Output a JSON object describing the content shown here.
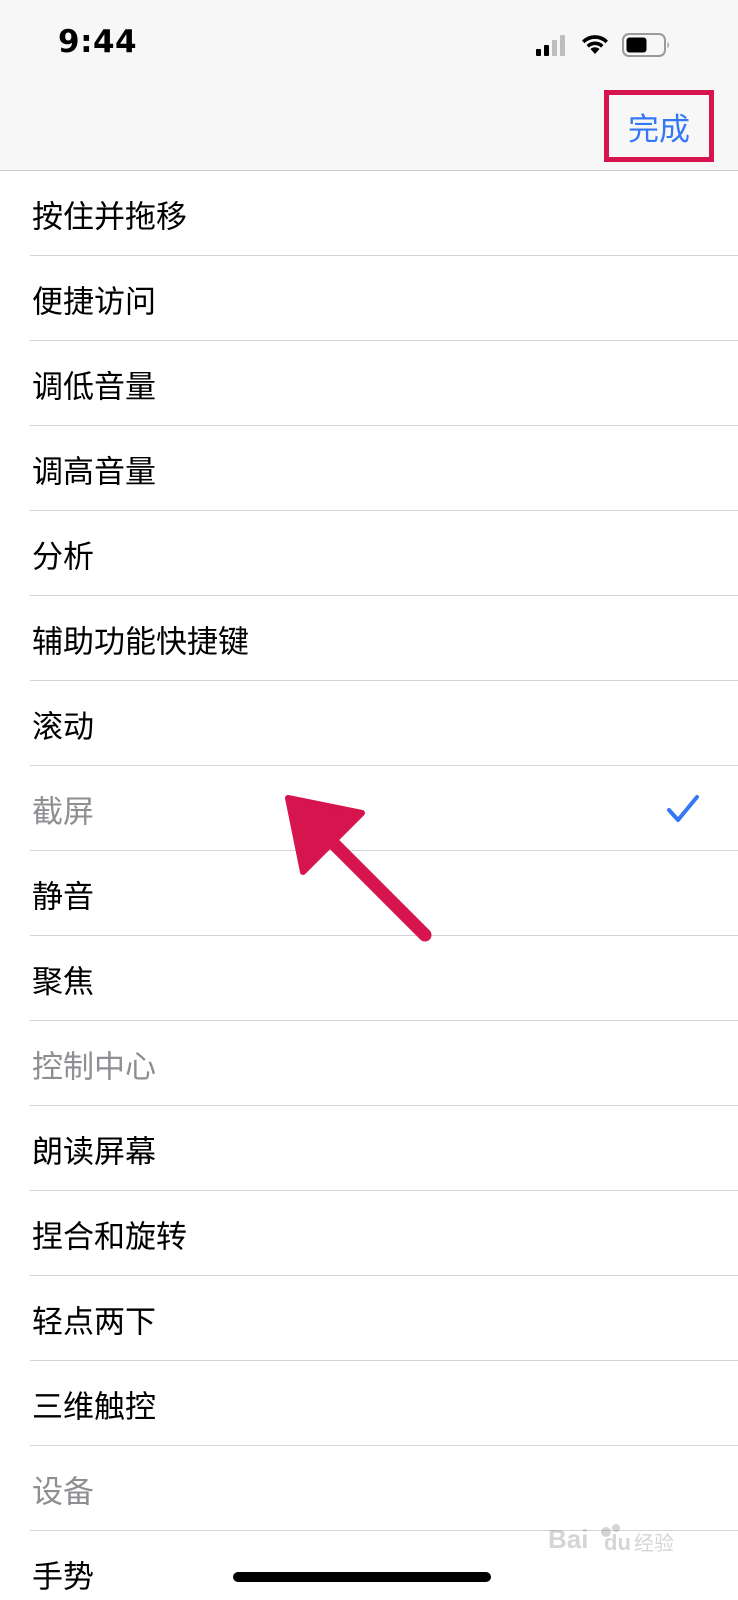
{
  "status_bar": {
    "time": "9:44"
  },
  "nav": {
    "done_label": "完成",
    "done_color": "#3478f6",
    "highlight_color": "#d6144d"
  },
  "list": {
    "items": [
      {
        "label": "按住并拖移",
        "disabled": false,
        "checked": false
      },
      {
        "label": "便捷访问",
        "disabled": false,
        "checked": false
      },
      {
        "label": "调低音量",
        "disabled": false,
        "checked": false
      },
      {
        "label": "调高音量",
        "disabled": false,
        "checked": false
      },
      {
        "label": "分析",
        "disabled": false,
        "checked": false
      },
      {
        "label": "辅助功能快捷键",
        "disabled": false,
        "checked": false
      },
      {
        "label": "滚动",
        "disabled": false,
        "checked": false
      },
      {
        "label": "截屏",
        "disabled": true,
        "checked": true
      },
      {
        "label": "静音",
        "disabled": false,
        "checked": false
      },
      {
        "label": "聚焦",
        "disabled": false,
        "checked": false
      },
      {
        "label": "控制中心",
        "disabled": true,
        "checked": false
      },
      {
        "label": "朗读屏幕",
        "disabled": false,
        "checked": false
      },
      {
        "label": "捏合和旋转",
        "disabled": false,
        "checked": false
      },
      {
        "label": "轻点两下",
        "disabled": false,
        "checked": false
      },
      {
        "label": "三维触控",
        "disabled": false,
        "checked": false
      },
      {
        "label": "设备",
        "disabled": true,
        "checked": false
      },
      {
        "label": "手势",
        "disabled": false,
        "checked": false
      }
    ]
  },
  "icons": {
    "checkmark": "checkmark-icon",
    "signal": "cellular-signal-icon",
    "wifi": "wifi-icon",
    "battery": "battery-icon",
    "annotation": "red-arrow-annotation"
  },
  "watermark": {
    "text": "Baidu经验"
  }
}
